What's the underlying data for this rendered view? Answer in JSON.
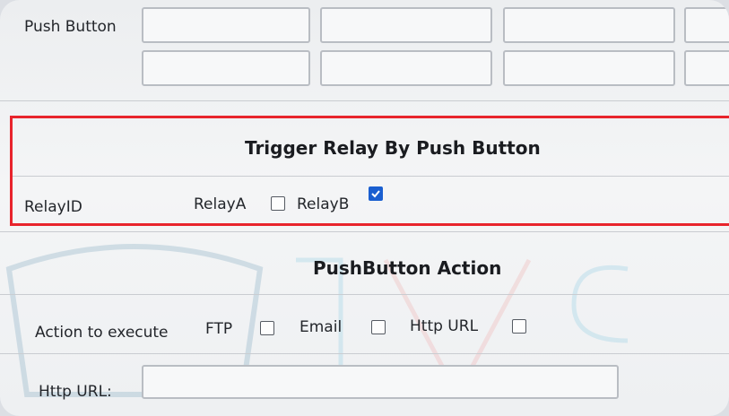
{
  "push_button_section": {
    "label": "Push Button"
  },
  "relay_section": {
    "title": "Trigger Relay By Push Button",
    "relay_id_label": "RelayID",
    "relay_a_label": "RelayA",
    "relay_a_checked": false,
    "relay_b_label": "RelayB",
    "relay_b_checked": true
  },
  "action_section": {
    "title": "PushButton Action",
    "action_label": "Action to execute",
    "ftp_label": "FTP",
    "email_label": "Email",
    "http_label": "Http URL",
    "http_url_label": "Http URL:",
    "http_url_value": ""
  },
  "colors": {
    "highlight_border": "#e8242c",
    "checkbox_checked": "#1a5fd0"
  }
}
